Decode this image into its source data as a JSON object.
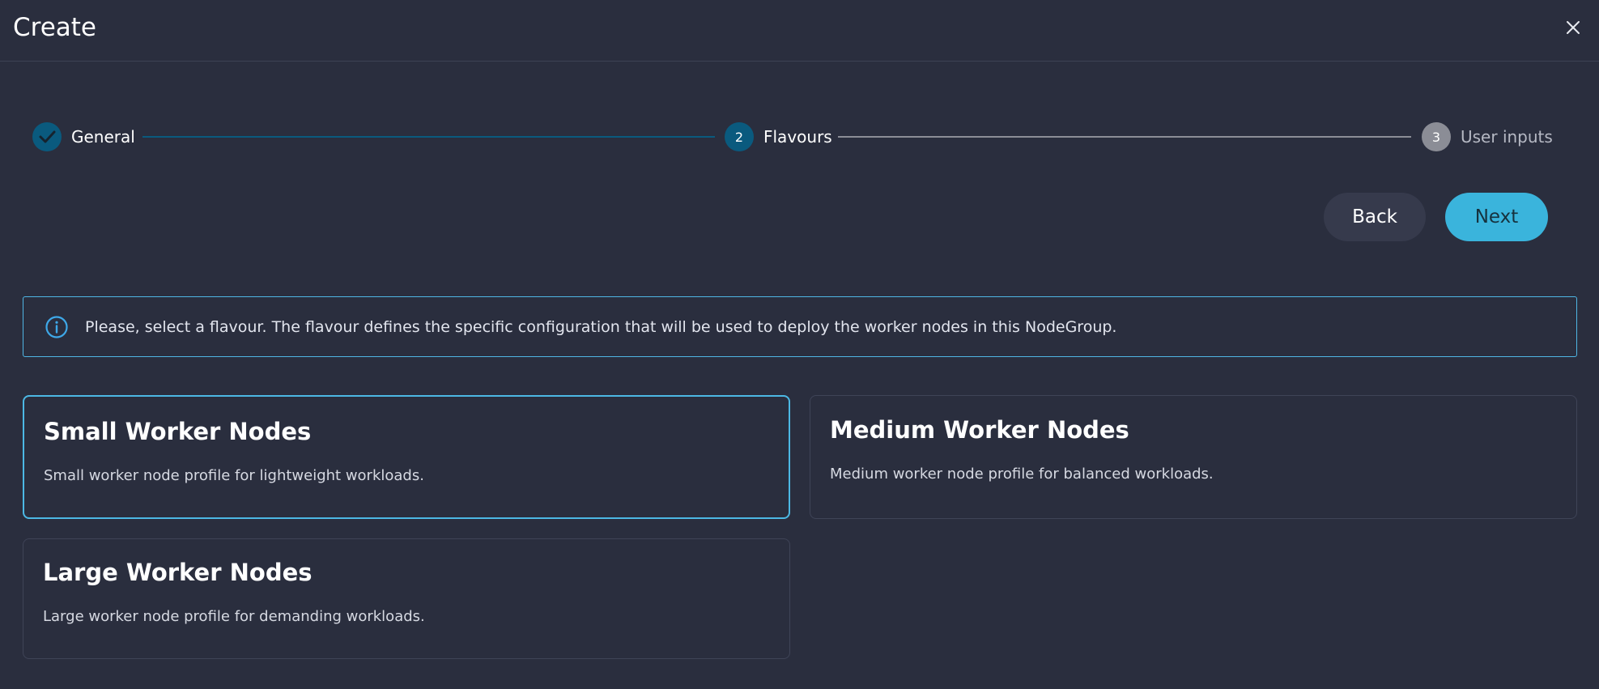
{
  "dialog": {
    "title": "Create"
  },
  "stepper": {
    "steps": [
      {
        "label": "General",
        "number": "1",
        "state": "completed"
      },
      {
        "label": "Flavours",
        "number": "2",
        "state": "active"
      },
      {
        "label": "User inputs",
        "number": "3",
        "state": "pending"
      }
    ]
  },
  "actions": {
    "back_label": "Back",
    "next_label": "Next"
  },
  "info": {
    "message": "Please, select a flavour. The flavour defines the specific configuration that will be used to deploy the worker nodes in this NodeGroup."
  },
  "flavours": [
    {
      "title": "Small Worker Nodes",
      "description": "Small worker node profile for lightweight workloads.",
      "selected": true
    },
    {
      "title": "Medium Worker Nodes",
      "description": "Medium worker node profile for balanced workloads.",
      "selected": false
    },
    {
      "title": "Large Worker Nodes",
      "description": "Large worker node profile for demanding workloads.",
      "selected": false
    }
  ],
  "colors": {
    "background": "#2a2e3e",
    "accent": "#3ab4dc",
    "completed_step": "#0a5a7e",
    "active_step": "#0a5a7e",
    "pending_step": "#8b8d96"
  },
  "icons": {
    "close": "close-icon",
    "completed_step": "check-icon",
    "info": "info-icon"
  }
}
